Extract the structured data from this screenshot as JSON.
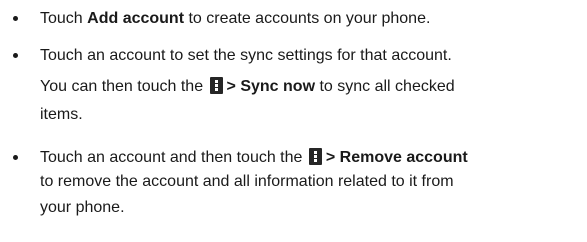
{
  "instructions": [
    {
      "prefix": "Touch ",
      "bold": "Add account",
      "suffix": " to create accounts on your phone."
    },
    {
      "line1": "Touch an account to set the sync settings for that account.",
      "line2_prefix": "You can then touch the ",
      "line2_icon": "menu-icon",
      "line2_bold": "> Sync now",
      "line2_suffix": " to sync all checked",
      "line3": "items."
    },
    {
      "line1_prefix": "Touch an account and then touch the ",
      "line1_icon": "menu-icon",
      "line1_bold": "> Remove account",
      "line2": "to remove the account and all information related to it from",
      "line3": "your phone."
    }
  ]
}
